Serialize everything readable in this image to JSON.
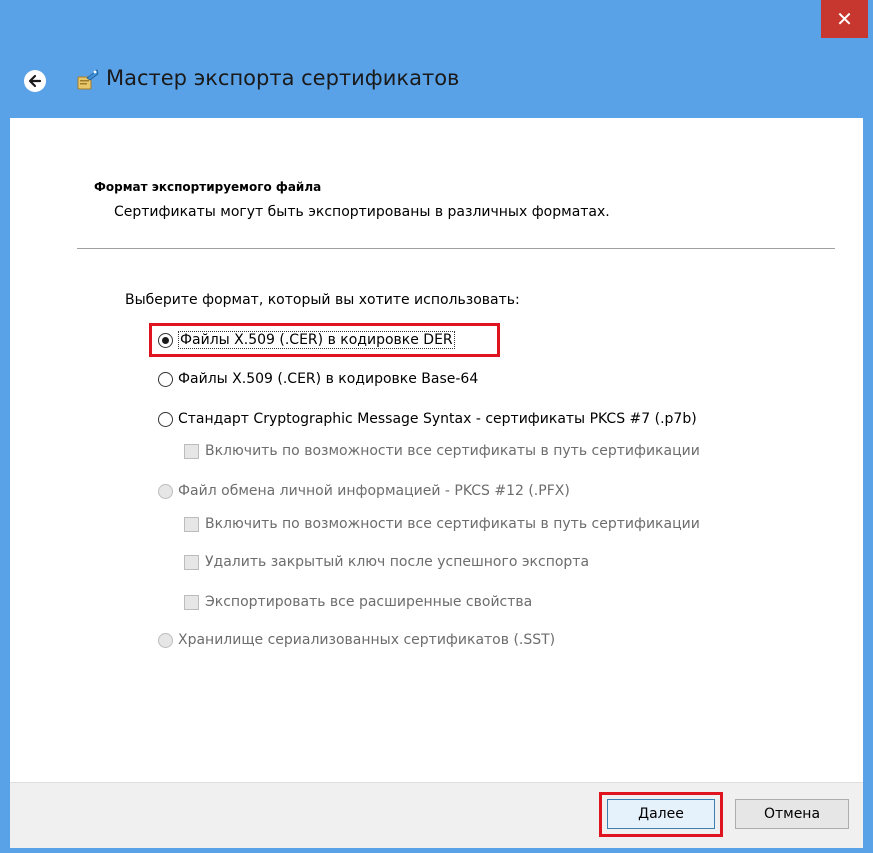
{
  "window": {
    "title": "Мастер экспорта сертификатов",
    "close_glyph": "✕"
  },
  "section": {
    "title": "Формат экспортируемого файла",
    "description": "Сертификаты могут быть экспортированы в различных форматах."
  },
  "prompt": "Выберите формат, который вы хотите использовать:",
  "options": [
    {
      "label": "Файлы X.509 (.CER) в кодировке DER",
      "type": "radio",
      "checked": true,
      "enabled": true
    },
    {
      "label": "Файлы X.509 (.CER) в кодировке Base-64",
      "type": "radio",
      "checked": false,
      "enabled": true
    },
    {
      "label": "Стандарт Cryptographic Message Syntax - сертификаты PKCS #7 (.p7b)",
      "type": "radio",
      "checked": false,
      "enabled": true
    },
    {
      "label": "Включить по возможности все сертификаты в путь сертификации",
      "type": "checkbox",
      "checked": false,
      "enabled": false
    },
    {
      "label": "Файл обмена личной информацией - PKCS #12 (.PFX)",
      "type": "radio",
      "checked": false,
      "enabled": false
    },
    {
      "label": "Включить по возможности все сертификаты в путь сертификации",
      "type": "checkbox",
      "checked": false,
      "enabled": false
    },
    {
      "label": "Удалить закрытый ключ после успешного экспорта",
      "type": "checkbox",
      "checked": false,
      "enabled": false
    },
    {
      "label": "Экспортировать все расширенные свойства",
      "type": "checkbox",
      "checked": false,
      "enabled": false
    },
    {
      "label": "Хранилище сериализованных сертификатов (.SST)",
      "type": "radio",
      "checked": false,
      "enabled": false
    }
  ],
  "buttons": {
    "next": "Далее",
    "cancel": "Отмена"
  },
  "icons": {
    "back": "back-arrow-icon",
    "wizard": "certificate-wizard-icon",
    "close": "close-icon"
  },
  "colors": {
    "title_bar": "#5aa2e8",
    "close": "#c7372f",
    "highlight": "#e0141e"
  }
}
